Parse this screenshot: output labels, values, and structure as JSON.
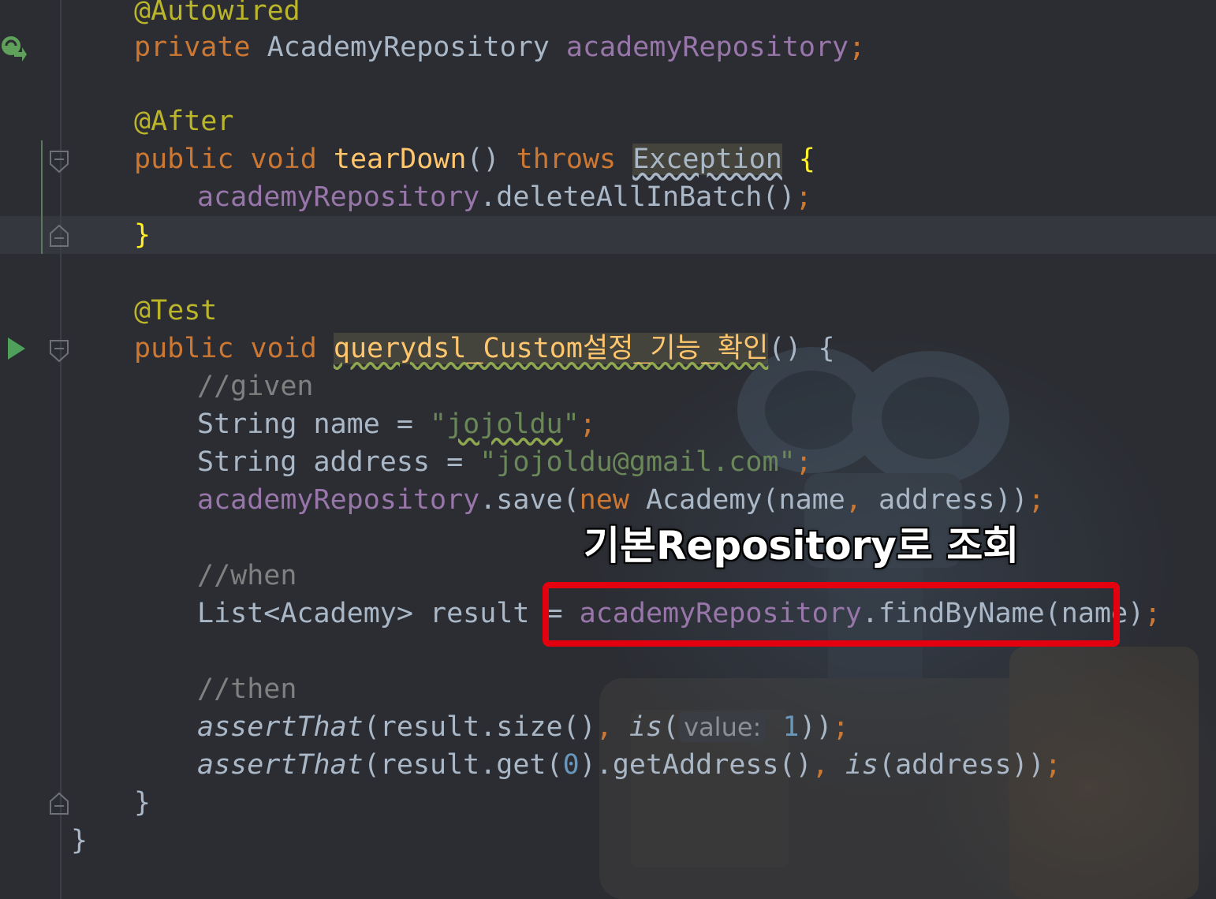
{
  "colors": {
    "background": "#2b2d33",
    "keyword": "#cc7832",
    "annotation": "#bbb529",
    "method_decl": "#ffc66d",
    "field": "#9876aa",
    "string": "#6a8759",
    "comment": "#808080",
    "number": "#6897bb",
    "default_text": "#a9b7c6",
    "highlight_box": "#e3000f"
  },
  "icons": {
    "bean_icon": "bean-navigation-icon",
    "run_icon": "run-test-icon",
    "fold_icon": "fold-marker-icon"
  },
  "code": {
    "l1": {
      "ann": "@Autowired"
    },
    "l2": {
      "kw": "private",
      "type": " AcademyRepository ",
      "field": "academyRepository",
      "semi": ";"
    },
    "l4": {
      "ann": "@After"
    },
    "l5": {
      "kw1": "public",
      "kw2": " void ",
      "fn": "tearDown",
      "paren": "() ",
      "kw3": "throws",
      "sp": " ",
      "exc": "Exception",
      "sp2": " ",
      "brace": "{"
    },
    "l6": {
      "field": "academyRepository",
      "call": ".deleteAllInBatch()",
      "semi": ";"
    },
    "l7": {
      "brace": "}"
    },
    "l9": {
      "ann": "@Test"
    },
    "l10": {
      "kw1": "public",
      "kw2": " void ",
      "fn": "querydsl_Custom설정_기능_확인",
      "rest": "() {"
    },
    "l11": {
      "cmt": "//given"
    },
    "l12": {
      "type": "String name = ",
      "q1": "\"",
      "str": "jojoldu",
      "q2": "\"",
      "semi": ";"
    },
    "l13": {
      "type": "String address = ",
      "str": "\"jojoldu@gmail.com\"",
      "semi": ";"
    },
    "l14": {
      "field": "academyRepository",
      "call1": ".save(",
      "kw": "new",
      "call2": " Academy(name",
      "comma": ",",
      "call3": " address))",
      "semi": ";"
    },
    "l16": {
      "cmt": "//when"
    },
    "l17": {
      "type": "List<Academy> result = ",
      "field": "academyRepository",
      "call": ".findByName(name)",
      "semi": ";"
    },
    "l19": {
      "cmt": "//then"
    },
    "l20": {
      "fn": "assertThat",
      "a": "(result.size()",
      "comma": ",",
      "sp": " ",
      "is": "is",
      "p": "(",
      "hint": "value:",
      "sp2": " ",
      "num": "1",
      "end": "))",
      "semi": ";"
    },
    "l21": {
      "fn": "assertThat",
      "a": "(result.get(",
      "num": "0",
      "b": ").getAddress()",
      "comma": ",",
      "sp": " ",
      "is": "is",
      "c": "(address))",
      "semi": ";"
    },
    "l22": {
      "brace": "}"
    },
    "l23": {
      "brace": "}"
    }
  },
  "annotation": {
    "label": "기본Repository로 조회"
  }
}
